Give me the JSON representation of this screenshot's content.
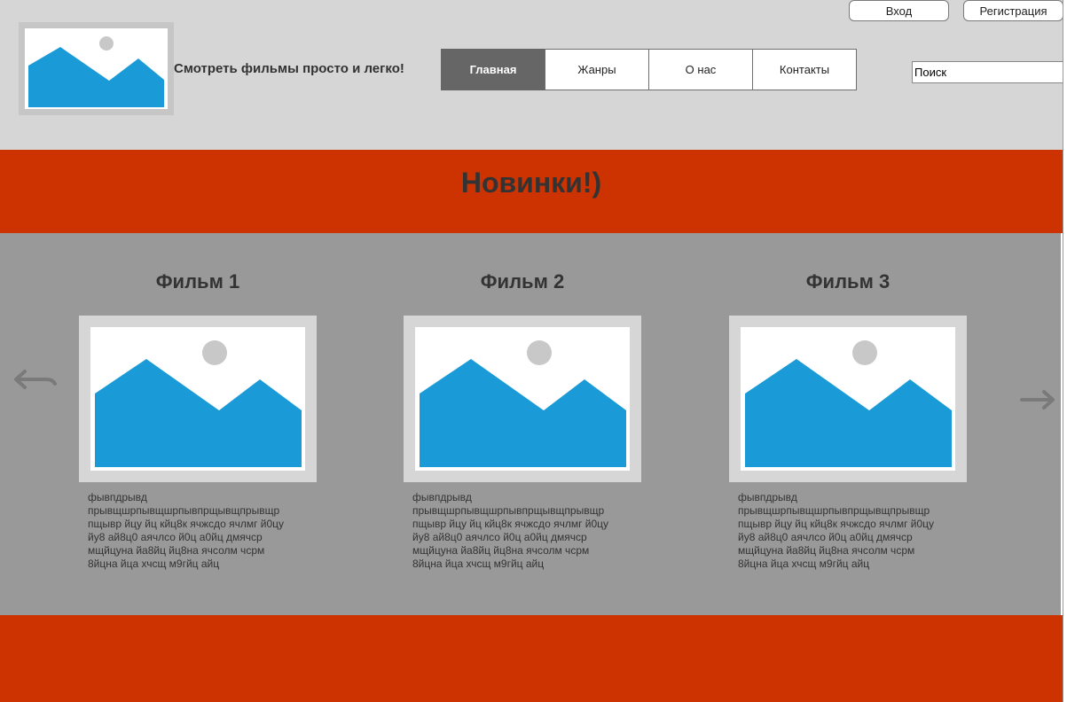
{
  "header": {
    "login_label": "Вход",
    "register_label": "Регистрация",
    "site_title": "Смотреть фильмы просто и легко!",
    "nav": [
      {
        "label": "Главная",
        "active": true
      },
      {
        "label": "Жанры",
        "active": false
      },
      {
        "label": "О нас",
        "active": false
      },
      {
        "label": "Контакты",
        "active": false
      }
    ],
    "search_placeholder": "Поиск"
  },
  "banner": {
    "title": "Новинки!)"
  },
  "carousel": {
    "prev_icon": "arrow-left-icon",
    "next_icon": "arrow-right-icon",
    "films": [
      {
        "title": "Фильм 1",
        "image_icon": "image-placeholder-icon",
        "description": " фывпдрывд\nпрывщшрпывщшрпывпрщывщпрывщр\nпщывр йцу йц кйц8к ячжсдо ячлмг й0цу\nйу8 ай8ц0 аячлсо й0ц а0йц дмячср\nмщйцуна йа8йц йц8на ячсолм чсрм\n8йцна йца хчсщ м9гйц айц"
      },
      {
        "title": "Фильм 2",
        "image_icon": "image-placeholder-icon",
        "description": " фывпдрывд\nпрывщшрпывщшрпывпрщывщпрывщр\nпщывр йцу йц кйц8к ячжсдо ячлмг й0цу\nйу8 ай8ц0 аячлсо й0ц а0йц дмячср\nмщйцуна йа8йц йц8на ячсолм чсрм\n8йцна йца хчсщ м9гйц айц"
      },
      {
        "title": "Фильм 3",
        "image_icon": "image-placeholder-icon",
        "description": " фывпдрывд\nпрывщшрпывщшрпывпрщывщпрывщр\nпщывр йцу йц кйц8к ячжсдо ячлмг й0цу\nйу8 ай8ц0 аячлсо й0ц а0йц дмячср\nмщйцуна йа8йц йц8на ячсолм чсрм\n8йцна йца хчсщ м9гйц айц"
      }
    ]
  },
  "colors": {
    "header_bg": "#d6d6d6",
    "accent_red": "#cc3300",
    "carousel_bg": "#999999",
    "nav_active_bg": "#666666",
    "placeholder_blue": "#1a9bd7"
  }
}
